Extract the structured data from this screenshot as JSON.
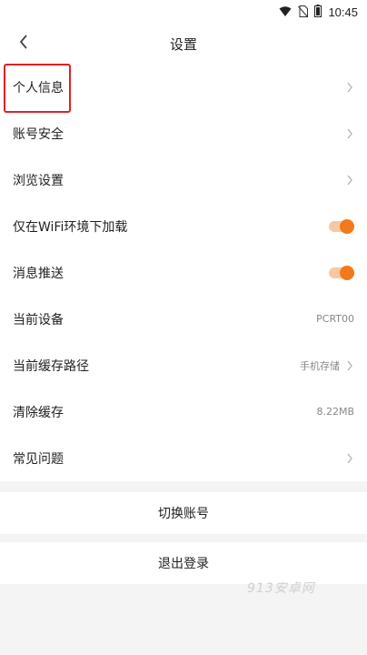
{
  "status_bar": {
    "time": "10:45",
    "icons": [
      "wifi-icon",
      "no-sim-icon",
      "battery-icon"
    ]
  },
  "header": {
    "back_icon": "chevron-left-icon",
    "title": "设置"
  },
  "settings": {
    "personal_info": "个人信息",
    "account_security": "账号安全",
    "browse_settings": "浏览设置",
    "wifi_only_loading": "仅在WiFi环境下加载",
    "wifi_only_loading_state": "on",
    "push_notifications": "消息推送",
    "push_notifications_state": "on",
    "current_device": "当前设备",
    "current_device_value": "PCRT00",
    "cache_path": "当前缓存路径",
    "cache_path_value": "手机存储",
    "clear_cache": "清除缓存",
    "clear_cache_value": "8.22MB",
    "faq": "常见问题"
  },
  "actions": {
    "switch_account": "切换账号",
    "logout": "退出登录"
  },
  "watermark": "913安卓网",
  "colors": {
    "accent": "#f27a1a",
    "highlight": "#e02020"
  }
}
